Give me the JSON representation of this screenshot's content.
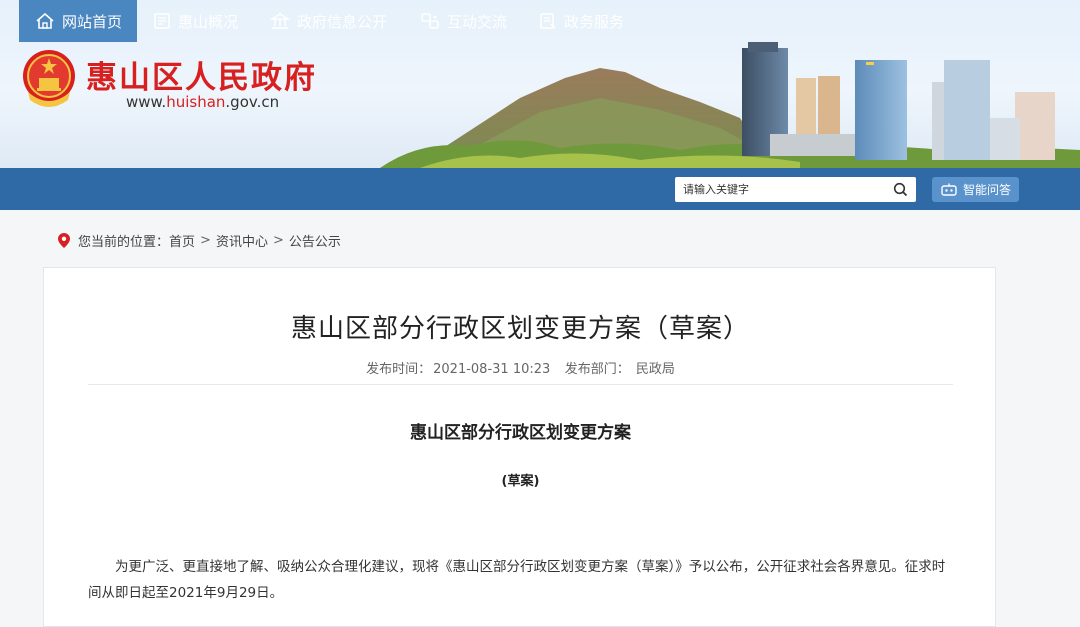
{
  "site": {
    "name": "惠山区人民政府",
    "url_prefix": "www.",
    "url_highlight": "huishan",
    "url_suffix": ".gov.cn"
  },
  "nav": {
    "items": [
      {
        "label": "网站首页",
        "icon": "home-icon",
        "active": true
      },
      {
        "label": "惠山概况",
        "icon": "document-icon",
        "active": false
      },
      {
        "label": "政府信息公开",
        "icon": "building-icon",
        "active": false
      },
      {
        "label": "互动交流",
        "icon": "exchange-icon",
        "active": false
      },
      {
        "label": "政务服务",
        "icon": "service-icon",
        "active": false
      }
    ],
    "search_placeholder": "请输入关键字",
    "ai_label": "智能问答"
  },
  "breadcrumb": {
    "prefix": "您当前的位置：",
    "items": [
      "首页",
      "资讯中心",
      "公告公示"
    ],
    "separator": ">"
  },
  "article": {
    "title": "惠山区部分行政区划变更方案（草案）",
    "publish_time_label": "发布时间：",
    "publish_time": "2021-08-31 10:23",
    "department_label": "发布部门：",
    "department": "民政局",
    "doc_title": "惠山区部分行政区划变更方案",
    "doc_subtitle": "(草案)",
    "paragraph_line1": "为更广泛、更直接地了解、吸纳公众合理化建议，现将《惠山区部分行政区划变更方案（草案）》予以公布，公开征求社会各界意见。征求时间",
    "paragraph_line2": "从即日起至2021年9月29日。"
  },
  "colors": {
    "brand_red": "#d7201f",
    "nav_blue": "#2f6aa6",
    "nav_active": "#4a86bf"
  }
}
